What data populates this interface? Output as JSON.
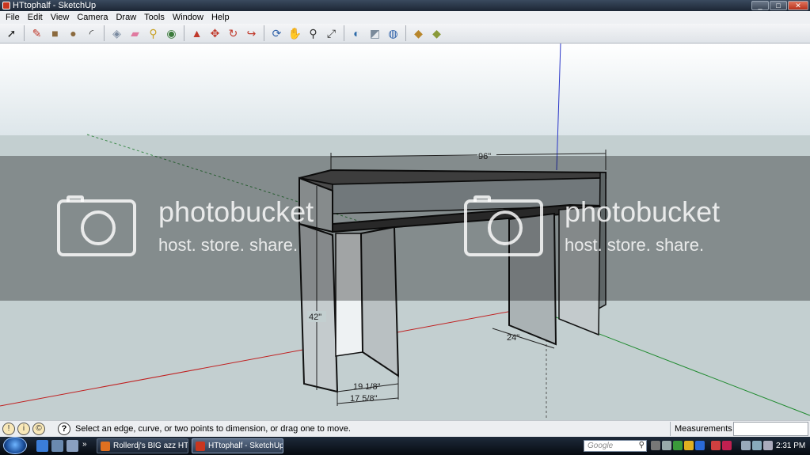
{
  "window": {
    "title": "HTtophalf - SketchUp",
    "controls": [
      "_",
      "□",
      "✕"
    ]
  },
  "menu": [
    "File",
    "Edit",
    "View",
    "Camera",
    "Draw",
    "Tools",
    "Window",
    "Help"
  ],
  "toolbar": {
    "tools": [
      {
        "name": "select-tool",
        "glyph": "➚",
        "color": "#222222"
      },
      {
        "sep": true
      },
      {
        "name": "pencil-tool",
        "glyph": "✎",
        "color": "#c0392b"
      },
      {
        "name": "rectangle-tool",
        "glyph": "■",
        "color": "#8b6a3e"
      },
      {
        "name": "circle-tool",
        "glyph": "●",
        "color": "#8b6a3e"
      },
      {
        "name": "arc-tool",
        "glyph": "◜",
        "color": "#333333"
      },
      {
        "sep": true
      },
      {
        "name": "make-component-tool",
        "glyph": "◈",
        "color": "#7a8aa0"
      },
      {
        "name": "eraser-tool",
        "glyph": "▰",
        "color": "#e07aa0"
      },
      {
        "name": "tape-measure-tool",
        "glyph": "⚲",
        "color": "#c9a227"
      },
      {
        "name": "paint-bucket-tool",
        "glyph": "◉",
        "color": "#3a7a3a"
      },
      {
        "sep": true
      },
      {
        "name": "push-pull-tool",
        "glyph": "▲",
        "color": "#c0392b"
      },
      {
        "name": "move-tool",
        "glyph": "✥",
        "color": "#c0392b"
      },
      {
        "name": "rotate-tool",
        "glyph": "↻",
        "color": "#c0392b"
      },
      {
        "name": "offset-tool",
        "glyph": "↪",
        "color": "#c0392b"
      },
      {
        "sep": true
      },
      {
        "name": "orbit-tool",
        "glyph": "⟳",
        "color": "#2c5fa8"
      },
      {
        "name": "pan-tool",
        "glyph": "✋",
        "color": "#555555"
      },
      {
        "name": "zoom-tool",
        "glyph": "⚲",
        "color": "#333333"
      },
      {
        "name": "zoom-extents-tool",
        "glyph": "⤢",
        "color": "#333333"
      },
      {
        "sep": true
      },
      {
        "name": "previous-view-tool",
        "glyph": "◐",
        "color": "#2c6aa8"
      },
      {
        "name": "next-view-tool",
        "glyph": "◩",
        "color": "#7a8a9a"
      },
      {
        "name": "get-models-tool",
        "glyph": "◍",
        "color": "#2c5fa8"
      },
      {
        "sep": true
      },
      {
        "name": "share-model-tool",
        "glyph": "◆",
        "color": "#b8862b"
      },
      {
        "name": "components-tool",
        "glyph": "◆",
        "color": "#8a9a3a"
      }
    ]
  },
  "model": {
    "dimensions": [
      "96\"",
      "42\"",
      "24\"",
      "19 1/8\"",
      "17 5/8\""
    ]
  },
  "watermark": {
    "brand": "photobucket",
    "tagline": "host. store. share."
  },
  "statusbar": {
    "hint": "Select an edge, curve, or two points to dimension, or drag one to move.",
    "measurements_label": "Measurements",
    "measurements_value": ""
  },
  "taskbar": {
    "tasks": [
      {
        "label": "Rollerdj's BIG azz HT...",
        "active": false,
        "icon_color": "#e07020"
      },
      {
        "label": "HTtophalf - SketchUp",
        "active": true,
        "icon_color": "#c8361f"
      }
    ],
    "search_placeholder": "Google",
    "clock": "2:31 PM"
  }
}
